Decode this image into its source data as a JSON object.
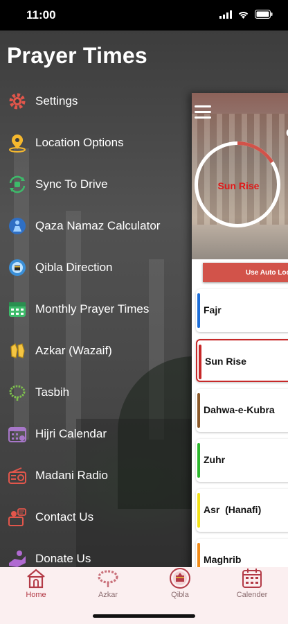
{
  "status": {
    "time": "11:00"
  },
  "drawer": {
    "title": "Prayer Times",
    "items": [
      {
        "label": "Settings",
        "icon": "gear-icon"
      },
      {
        "label": "Location Options",
        "icon": "location-pin-icon"
      },
      {
        "label": "Sync To Drive",
        "icon": "sync-icon"
      },
      {
        "label": "Qaza Namaz Calculator",
        "icon": "praying-person-icon"
      },
      {
        "label": "Qibla Direction",
        "icon": "kaaba-icon"
      },
      {
        "label": "Monthly Prayer Times",
        "icon": "calendar-grid-icon"
      },
      {
        "label": "Azkar (Wazaif)",
        "icon": "praying-hands-icon"
      },
      {
        "label": "Tasbih",
        "icon": "tasbih-beads-icon"
      },
      {
        "label": "Hijri Calendar",
        "icon": "hijri-calendar-icon"
      },
      {
        "label": "Madani Radio",
        "icon": "radio-icon"
      },
      {
        "label": "Contact Us",
        "icon": "contact-icon"
      },
      {
        "label": "Donate Us",
        "icon": "donate-hand-icon"
      }
    ]
  },
  "main": {
    "current_prayer": "Sun Rise",
    "auto_location_button": "Use Auto Loc",
    "peek_letter": "C",
    "prayers": [
      {
        "name": "Fajr",
        "color": "#1e6fd9",
        "active": false
      },
      {
        "name": "Sun Rise",
        "color": "#c62828",
        "active": true
      },
      {
        "name": "Dahwa-e-Kubra",
        "color": "#8b5a2b",
        "active": false
      },
      {
        "name": "Zuhr",
        "color": "#2eb82e",
        "active": false
      },
      {
        "name": "Asr  (Hanafi)",
        "color": "#f2e21a",
        "active": false
      },
      {
        "name": "Maghrib",
        "color": "#f28c1a",
        "active": false
      }
    ]
  },
  "tabs": [
    {
      "label": "Home",
      "icon": "mosque-home-icon",
      "active": true
    },
    {
      "label": "Azkar",
      "icon": "tasbih-icon",
      "active": false
    },
    {
      "label": "Qibla",
      "icon": "kaaba-compass-icon",
      "active": false
    },
    {
      "label": "Calender",
      "icon": "calendar-icon",
      "active": false
    }
  ],
  "colors": {
    "accent": "#b33a46",
    "tab_bg": "#fbeff0",
    "alert_red": "#d2534a"
  }
}
